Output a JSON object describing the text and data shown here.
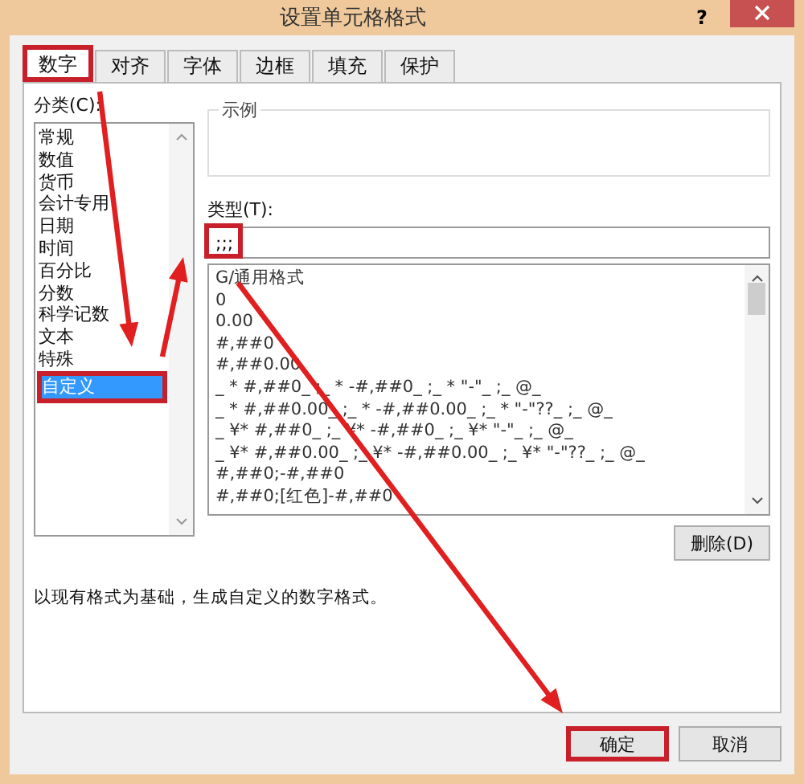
{
  "window": {
    "title": "设置单元格格式",
    "help": "?"
  },
  "tabs": [
    {
      "label": "数字",
      "selected": true,
      "highlighted": true
    },
    {
      "label": "对齐",
      "selected": false,
      "highlighted": false
    },
    {
      "label": "字体",
      "selected": false,
      "highlighted": false
    },
    {
      "label": "边框",
      "selected": false,
      "highlighted": false
    },
    {
      "label": "填充",
      "selected": false,
      "highlighted": false
    },
    {
      "label": "保护",
      "selected": false,
      "highlighted": false
    }
  ],
  "category": {
    "label": "分类(C):",
    "items": [
      {
        "label": "常规",
        "selected": false,
        "highlighted": false
      },
      {
        "label": "数值",
        "selected": false,
        "highlighted": false
      },
      {
        "label": "货币",
        "selected": false,
        "highlighted": false
      },
      {
        "label": "会计专用",
        "selected": false,
        "highlighted": false
      },
      {
        "label": "日期",
        "selected": false,
        "highlighted": false
      },
      {
        "label": "时间",
        "selected": false,
        "highlighted": false
      },
      {
        "label": "百分比",
        "selected": false,
        "highlighted": false
      },
      {
        "label": "分数",
        "selected": false,
        "highlighted": false
      },
      {
        "label": "科学记数",
        "selected": false,
        "highlighted": false
      },
      {
        "label": "文本",
        "selected": false,
        "highlighted": false
      },
      {
        "label": "特殊",
        "selected": false,
        "highlighted": false
      },
      {
        "label": "自定义",
        "selected": true,
        "highlighted": true
      }
    ]
  },
  "sample": {
    "label": "示例"
  },
  "type": {
    "label": "类型(T):",
    "value": ";;;",
    "highlighted": true,
    "formats": [
      "G/通用格式",
      "0",
      "0.00",
      "#,##0",
      "#,##0.00",
      "_ * #,##0_ ;_ * -#,##0_ ;_ * \"-\"_ ;_ @_",
      "_ * #,##0.00_ ;_ * -#,##0.00_ ;_ * \"-\"??_ ;_ @_",
      "_ ¥* #,##0_ ;_ ¥* -#,##0_ ;_ ¥* \"-\"_ ;_ @_",
      "_ ¥* #,##0.00_ ;_ ¥* -#,##0.00_ ;_ ¥* \"-\"??_ ;_ @_",
      "#,##0;-#,##0",
      "#,##0;[红色]-#,##0"
    ]
  },
  "delete_button": "删除(D)",
  "description": "以现有格式为基础，生成自定义的数字格式。",
  "buttons": [
    {
      "label": "确定",
      "highlighted": true
    },
    {
      "label": "取消",
      "highlighted": false
    }
  ]
}
